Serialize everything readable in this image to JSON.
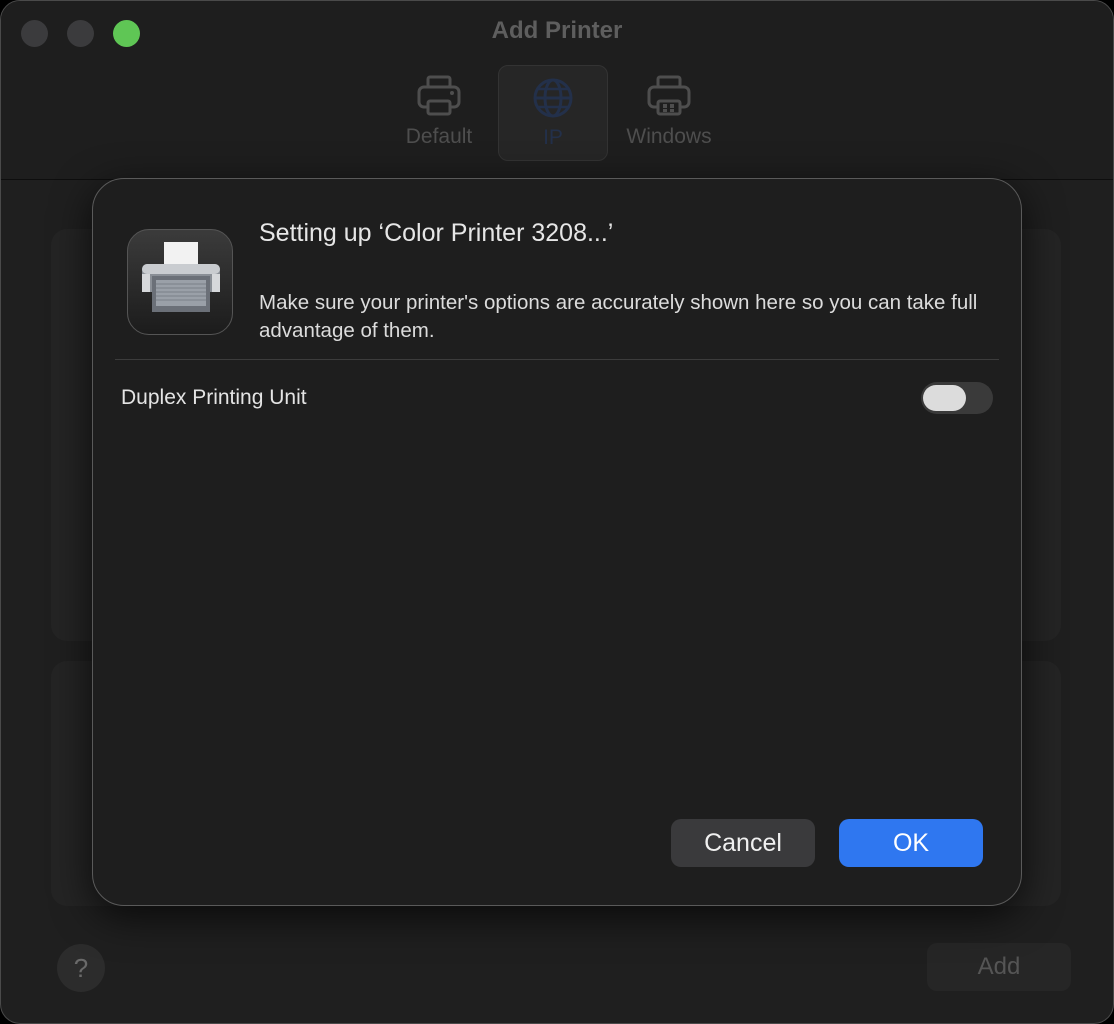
{
  "window": {
    "title": "Add Printer",
    "toolbar": [
      {
        "label": "Default",
        "icon": "printer-icon"
      },
      {
        "label": "IP",
        "icon": "globe-icon",
        "selected": true
      },
      {
        "label": "Windows",
        "icon": "windows-printer-icon"
      }
    ],
    "help_label": "?",
    "add_label": "Add"
  },
  "sheet": {
    "title": "Setting up ‘Color Printer 3208...’",
    "message": "Make sure your printer's options are accurately shown here so you can take full advantage of them.",
    "options": [
      {
        "label": "Duplex Printing Unit",
        "enabled": false
      }
    ],
    "cancel_label": "Cancel",
    "ok_label": "OK"
  },
  "colors": {
    "accent": "#2f77f0",
    "zoom_button": "#5fc655"
  }
}
